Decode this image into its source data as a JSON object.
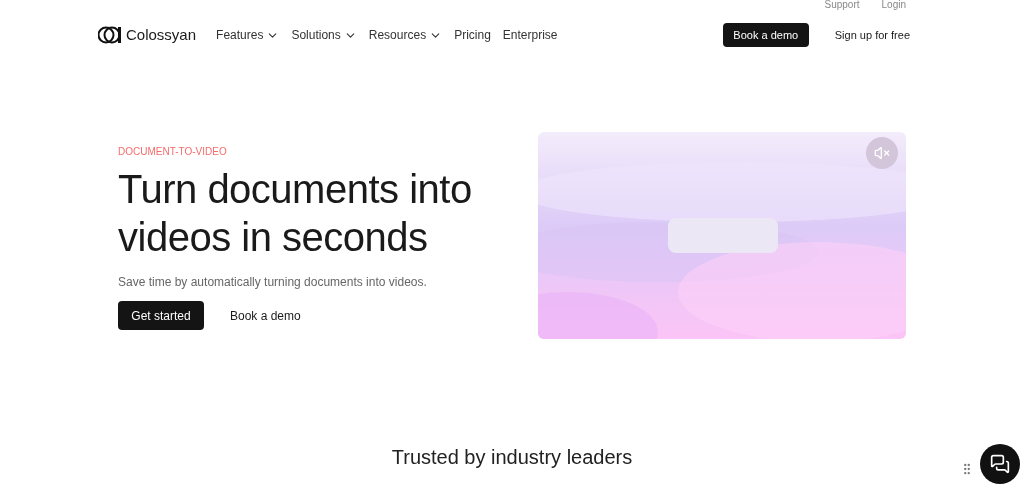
{
  "top_links": [
    "Support",
    "Login"
  ],
  "nav": {
    "logo": "Colossyan",
    "items": [
      {
        "label": "Features",
        "kind": "dropdown"
      },
      {
        "label": "Solutions",
        "kind": "dropdown"
      },
      {
        "label": "Resources",
        "kind": "dropdown"
      },
      {
        "label": "Pricing",
        "kind": "link"
      },
      {
        "label": "Enterprise",
        "kind": "link"
      }
    ],
    "demo_button": "Book a demo",
    "signup": "Sign up for free"
  },
  "hero": {
    "eyebrow": "DOCUMENT-TO-VIDEO",
    "title": "Turn documents into videos in seconds",
    "subtitle": "Save time by automatically turning documents into videos.",
    "primary": "Get started",
    "secondary": "Book a demo"
  },
  "video": {
    "kind": "picture",
    "muted": true
  },
  "trusted": "Trusted by industry leaders"
}
